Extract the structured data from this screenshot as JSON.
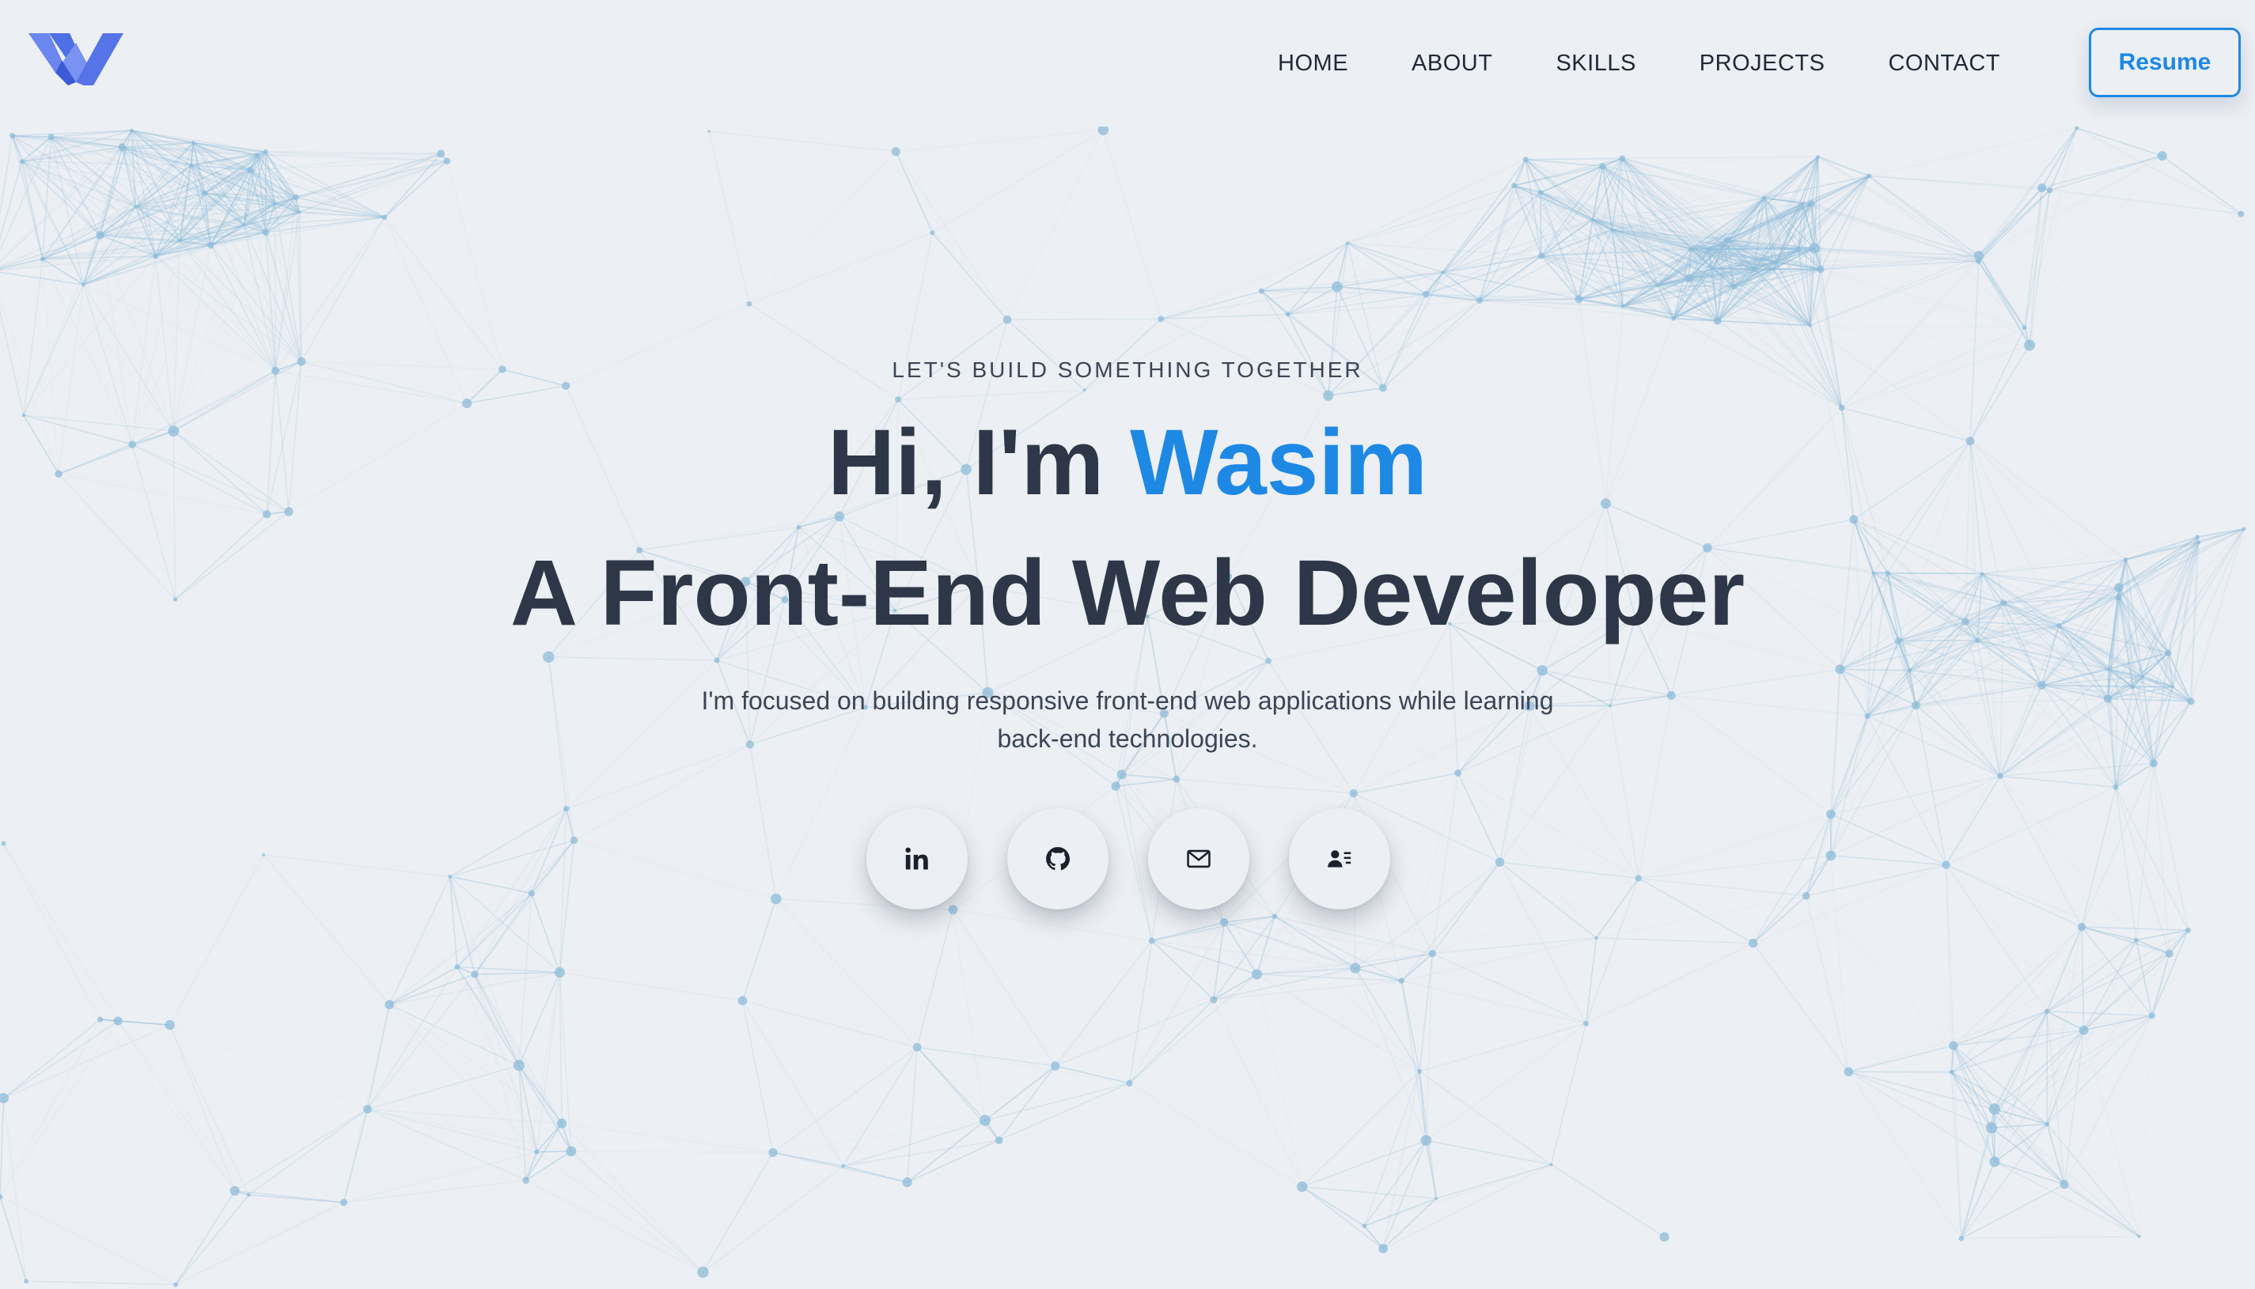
{
  "nav": {
    "logo_name": "w-logo",
    "links": [
      {
        "label": "HOME"
      },
      {
        "label": "ABOUT"
      },
      {
        "label": "SKILLS"
      },
      {
        "label": "PROJECTS"
      },
      {
        "label": "CONTACT"
      }
    ],
    "resume_label": "Resume"
  },
  "hero": {
    "tagline": "LET'S BUILD SOMETHING TOGETHER",
    "greeting": "Hi, I'm ",
    "name": "Wasim",
    "role": "A Front-End Web Developer",
    "description": "I'm focused on building responsive front-end web applications while learning back-end technologies."
  },
  "socials": [
    {
      "icon": "linkedin-icon"
    },
    {
      "icon": "github-icon"
    },
    {
      "icon": "mail-icon"
    },
    {
      "icon": "contact-card-icon"
    }
  ],
  "colors": {
    "accent": "#1e88e5",
    "text": "#2d3748",
    "background": "#eceff3",
    "network": "#8fbcd9",
    "logo": "#5a78e8"
  }
}
